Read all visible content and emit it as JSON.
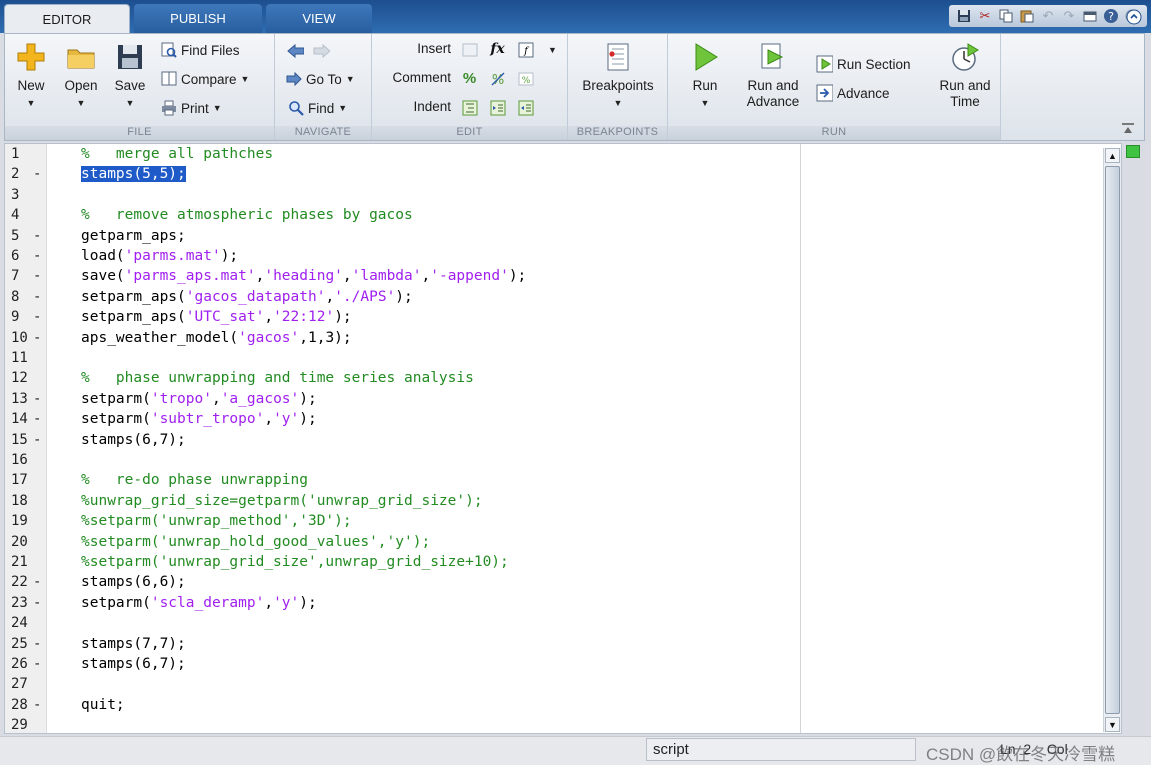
{
  "tabs": [
    {
      "label": "EDITOR",
      "active": true
    },
    {
      "label": "PUBLISH",
      "active": false
    },
    {
      "label": "VIEW",
      "active": false
    }
  ],
  "quick_access_icons": [
    "save-icon",
    "cut-icon",
    "copy-icon",
    "paste-icon",
    "undo-icon",
    "redo-icon",
    "switch-windows-icon",
    "help-icon",
    "minimize-icon",
    "expand-icon"
  ],
  "ribbon": {
    "file": {
      "label": "FILE",
      "new": "New",
      "open": "Open",
      "save": "Save",
      "find_files": "Find Files",
      "compare": "Compare",
      "print": "Print"
    },
    "navigate": {
      "label": "NAVIGATE",
      "go_to": "Go To",
      "find": "Find"
    },
    "edit": {
      "label": "EDIT",
      "insert": "Insert",
      "comment": "Comment",
      "indent": "Indent"
    },
    "breakpoints": {
      "label": "BREAKPOINTS",
      "breakpoints": "Breakpoints"
    },
    "run": {
      "label": "RUN",
      "run": "Run",
      "run_and_advance_1": "Run and",
      "run_and_advance_2": "Advance",
      "run_section": "Run Section",
      "advance": "Advance",
      "run_and_time_1": "Run and",
      "run_and_time_2": "Time"
    }
  },
  "editor": {
    "lines": [
      {
        "n": "1",
        "mark": " ",
        "parts": [
          {
            "t": "%   merge all pathches",
            "c": "cm"
          }
        ]
      },
      {
        "n": "2",
        "mark": "-",
        "parts": [
          {
            "t": "stamps(5,5);",
            "c": "sel"
          }
        ]
      },
      {
        "n": "3",
        "mark": " ",
        "parts": []
      },
      {
        "n": "4",
        "mark": " ",
        "parts": [
          {
            "t": "%   remove atmospheric phases by gacos",
            "c": "cm"
          }
        ]
      },
      {
        "n": "5",
        "mark": "-",
        "parts": [
          {
            "t": "getparm_aps;",
            "c": "tx"
          }
        ]
      },
      {
        "n": "6",
        "mark": "-",
        "parts": [
          {
            "t": "load(",
            "c": "tx"
          },
          {
            "t": "'parms.mat'",
            "c": "st"
          },
          {
            "t": ");",
            "c": "tx"
          }
        ]
      },
      {
        "n": "7",
        "mark": "-",
        "parts": [
          {
            "t": "save(",
            "c": "tx"
          },
          {
            "t": "'parms_aps.mat'",
            "c": "st"
          },
          {
            "t": ",",
            "c": "tx"
          },
          {
            "t": "'heading'",
            "c": "st"
          },
          {
            "t": ",",
            "c": "tx"
          },
          {
            "t": "'lambda'",
            "c": "st"
          },
          {
            "t": ",",
            "c": "tx"
          },
          {
            "t": "'-append'",
            "c": "st"
          },
          {
            "t": ");",
            "c": "tx"
          }
        ]
      },
      {
        "n": "8",
        "mark": "-",
        "parts": [
          {
            "t": "setparm_aps(",
            "c": "tx"
          },
          {
            "t": "'gacos_datapath'",
            "c": "st"
          },
          {
            "t": ",",
            "c": "tx"
          },
          {
            "t": "'./APS'",
            "c": "st"
          },
          {
            "t": ");",
            "c": "tx"
          }
        ]
      },
      {
        "n": "9",
        "mark": "-",
        "parts": [
          {
            "t": "setparm_aps(",
            "c": "tx"
          },
          {
            "t": "'UTC_sat'",
            "c": "st"
          },
          {
            "t": ",",
            "c": "tx"
          },
          {
            "t": "'22:12'",
            "c": "st"
          },
          {
            "t": ");",
            "c": "tx"
          }
        ]
      },
      {
        "n": "10",
        "mark": "-",
        "parts": [
          {
            "t": "aps_weather_model(",
            "c": "tx"
          },
          {
            "t": "'gacos'",
            "c": "st"
          },
          {
            "t": ",1,3);",
            "c": "tx"
          }
        ]
      },
      {
        "n": "11",
        "mark": " ",
        "parts": []
      },
      {
        "n": "12",
        "mark": " ",
        "parts": [
          {
            "t": "%   phase unwrapping and time series analysis",
            "c": "cm"
          }
        ]
      },
      {
        "n": "13",
        "mark": "-",
        "parts": [
          {
            "t": "setparm(",
            "c": "tx"
          },
          {
            "t": "'tropo'",
            "c": "st"
          },
          {
            "t": ",",
            "c": "tx"
          },
          {
            "t": "'a_gacos'",
            "c": "st"
          },
          {
            "t": ");",
            "c": "tx"
          }
        ]
      },
      {
        "n": "14",
        "mark": "-",
        "parts": [
          {
            "t": "setparm(",
            "c": "tx"
          },
          {
            "t": "'subtr_tropo'",
            "c": "st"
          },
          {
            "t": ",",
            "c": "tx"
          },
          {
            "t": "'y'",
            "c": "st"
          },
          {
            "t": ");",
            "c": "tx"
          }
        ]
      },
      {
        "n": "15",
        "mark": "-",
        "parts": [
          {
            "t": "stamps(6,7);",
            "c": "tx"
          }
        ]
      },
      {
        "n": "16",
        "mark": " ",
        "parts": []
      },
      {
        "n": "17",
        "mark": " ",
        "parts": [
          {
            "t": "%   re-do phase unwrapping",
            "c": "cm"
          }
        ]
      },
      {
        "n": "18",
        "mark": " ",
        "parts": [
          {
            "t": "%unwrap_grid_size=getparm('unwrap_grid_size');",
            "c": "cm"
          }
        ]
      },
      {
        "n": "19",
        "mark": " ",
        "parts": [
          {
            "t": "%setparm('unwrap_method','3D');",
            "c": "cm"
          }
        ]
      },
      {
        "n": "20",
        "mark": " ",
        "parts": [
          {
            "t": "%setparm('unwrap_hold_good_values','y');",
            "c": "cm"
          }
        ]
      },
      {
        "n": "21",
        "mark": " ",
        "parts": [
          {
            "t": "%setparm('unwrap_grid_size',unwrap_grid_size+10);",
            "c": "cm"
          }
        ]
      },
      {
        "n": "22",
        "mark": "-",
        "parts": [
          {
            "t": "stamps(6,6);",
            "c": "tx"
          }
        ]
      },
      {
        "n": "23",
        "mark": "-",
        "parts": [
          {
            "t": "setparm(",
            "c": "tx"
          },
          {
            "t": "'scla_deramp'",
            "c": "st"
          },
          {
            "t": ",",
            "c": "tx"
          },
          {
            "t": "'y'",
            "c": "st"
          },
          {
            "t": ");",
            "c": "tx"
          }
        ]
      },
      {
        "n": "24",
        "mark": " ",
        "parts": []
      },
      {
        "n": "25",
        "mark": "-",
        "parts": [
          {
            "t": "stamps(7,7);",
            "c": "tx"
          }
        ]
      },
      {
        "n": "26",
        "mark": "-",
        "parts": [
          {
            "t": "stamps(6,7);",
            "c": "tx"
          }
        ]
      },
      {
        "n": "27",
        "mark": " ",
        "parts": []
      },
      {
        "n": "28",
        "mark": "-",
        "parts": [
          {
            "t": "quit;",
            "c": "tx"
          }
        ]
      },
      {
        "n": "29",
        "mark": " ",
        "parts": []
      }
    ]
  },
  "statusbar": {
    "file_type": "script",
    "position": "Ln  2    Col",
    "watermark": "CSDN @飲在冬天冷雪糕"
  },
  "colors": {
    "comment": "#228b22",
    "string": "#a020f0",
    "selection": "#1e5ac8",
    "tab_strip": "#2f6db1"
  }
}
